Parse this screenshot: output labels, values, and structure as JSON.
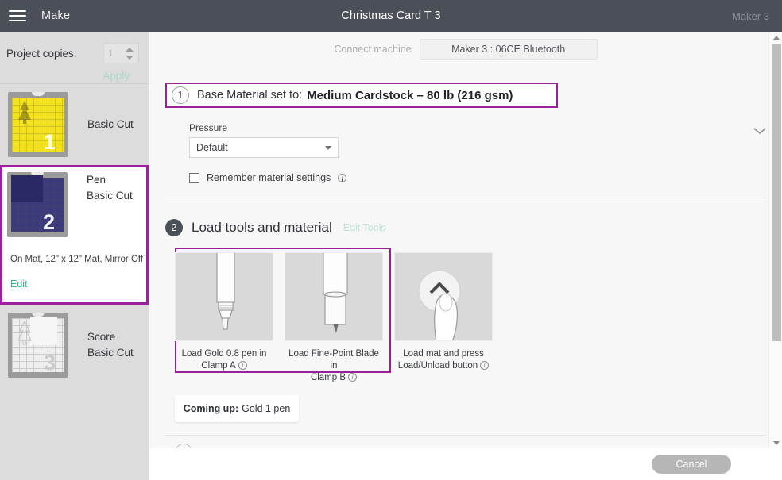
{
  "topbar": {
    "menu_icon": "hamburger-icon",
    "make_label": "Make",
    "project_title": "Christmas Card T 3",
    "machine_label": "Maker 3"
  },
  "sidebar": {
    "copies_label": "Project copies:",
    "copies_value": "1",
    "apply_label": "Apply",
    "mats": [
      {
        "number": "1",
        "labels": [
          "Basic Cut"
        ],
        "thumb": "yellow",
        "selected": false
      },
      {
        "number": "2",
        "labels": [
          "Pen",
          "Basic Cut"
        ],
        "thumb": "blue",
        "selected": true,
        "sub": "On Mat, 12\" x 12\" Mat, Mirror Off",
        "edit": "Edit"
      },
      {
        "number": "3",
        "labels": [
          "Score",
          "Basic Cut"
        ],
        "thumb": "white",
        "selected": false
      }
    ]
  },
  "main": {
    "connect": {
      "label": "Connect machine",
      "machine_button": "Maker 3 : 06CE Bluetooth"
    },
    "step1": {
      "badge": "1",
      "label": "Base Material set to:",
      "value": "Medium Cardstock – 80 lb (216 gsm)",
      "collapse_icon": "chevron-down-icon"
    },
    "material": {
      "pressure_label": "Pressure",
      "pressure_value": "Default",
      "remember_label": "Remember material settings",
      "remember_info": "info-icon",
      "remember_checked": false
    },
    "step2": {
      "badge": "2",
      "title": "Load tools and material",
      "edit_tools": "Edit Tools"
    },
    "tools": [
      {
        "icon": "pen-tip-icon",
        "line1": "Load Gold 0.8 pen in",
        "line2": "Clamp A",
        "info": "info-icon"
      },
      {
        "icon": "blade-tip-icon",
        "line1": "Load Fine-Point Blade in",
        "line2": "Clamp B",
        "info": "info-icon"
      },
      {
        "icon": "press-button-icon",
        "line1": "Load mat and press",
        "line2": "Load/Unload button",
        "info": "info-icon"
      }
    ],
    "coming_up": {
      "label": "Coming up:",
      "value": "Gold 1 pen"
    }
  },
  "footer": {
    "cancel_label": "Cancel"
  },
  "colors": {
    "topbar": "#4b4f58",
    "highlight_purple": "#9c1f9c",
    "accent_green": "#2eb88a",
    "panel_bg": "#f7f7f7",
    "sidebar_bg": "#dcdcdc"
  }
}
